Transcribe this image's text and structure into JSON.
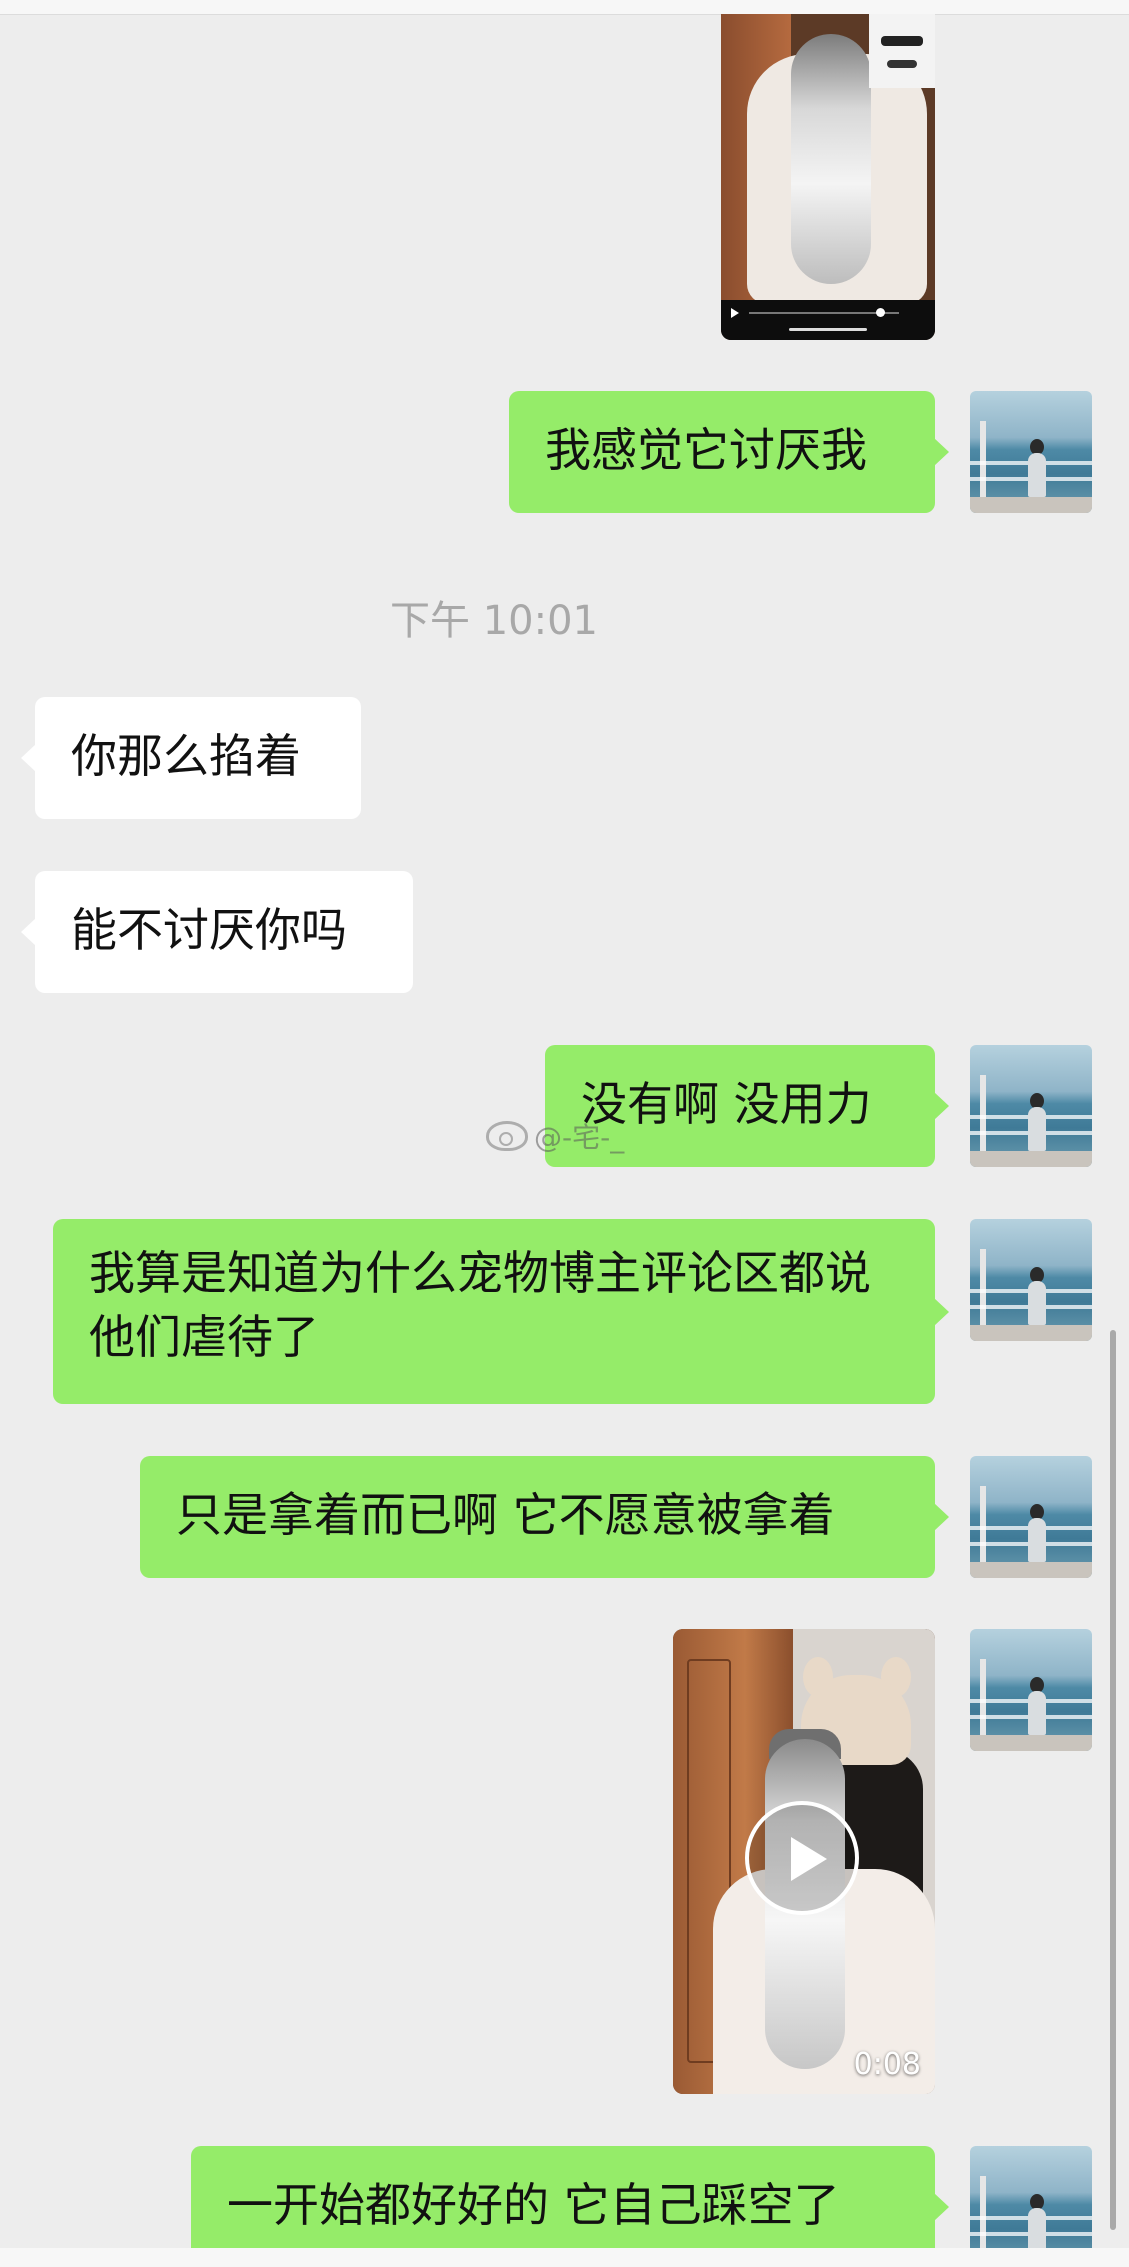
{
  "chat": {
    "timestamp": "下午 10:01",
    "messages": {
      "m1": "我感觉它讨厌我",
      "m2": "你那么掐着",
      "m3": "能不讨厌你吗",
      "m4": "没有啊 没用力",
      "m5": "我算是知道为什么宠物博主评论区都说他们虐待了",
      "m6": "只是拿着而已啊 它不愿意被拿着",
      "m7": "一开始都好好的 它自己踩空了"
    },
    "video": {
      "duration": "0:08"
    },
    "watermark": "@-宅-_"
  },
  "colors": {
    "background": "#ededed",
    "sent_bubble": "#95ec69",
    "received_bubble": "#ffffff",
    "timestamp_text": "#a8a8a8"
  }
}
